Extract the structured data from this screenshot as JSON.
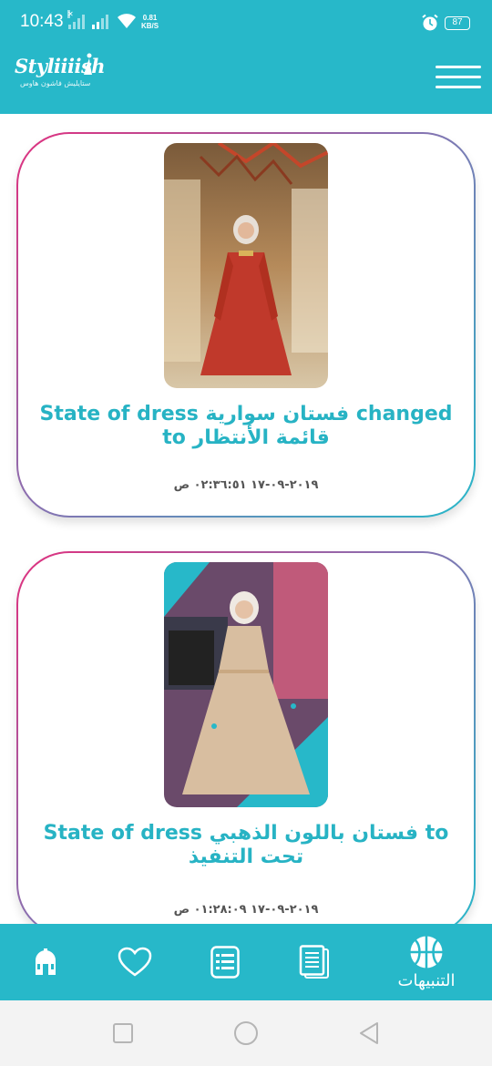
{
  "status_bar": {
    "time": "10:43",
    "net_speed_value": "0.81",
    "net_speed_unit": "KB/S",
    "battery": "87"
  },
  "app_bar": {
    "logo_text": "Styliiiish",
    "logo_tagline": "ستايليش فاشون هاوس"
  },
  "notifications": [
    {
      "title": "State of dress فستان سوارية changed to قائمة الأنتظار",
      "date": "٢٠١٩-٠٩-١٧ ٠٢:٣٦:٥١ ص",
      "image": "dress-photo"
    },
    {
      "title": "State of dress فستان باللون الذهبي to تحت التنفيذ",
      "date": "٢٠١٩-٠٩-١٧ ٠١:٢٨:٠٩ ص",
      "image": "dress-photo"
    }
  ],
  "bottom_nav": {
    "active_label": "التنبيهات",
    "items": [
      "home-icon",
      "heart-icon",
      "list-icon",
      "documents-icon",
      "basketball-icon"
    ]
  },
  "colors": {
    "primary": "#27b8c9",
    "title": "#27b3c4",
    "card_border_start": "#e0307e",
    "card_border_end": "#27b8c9"
  }
}
